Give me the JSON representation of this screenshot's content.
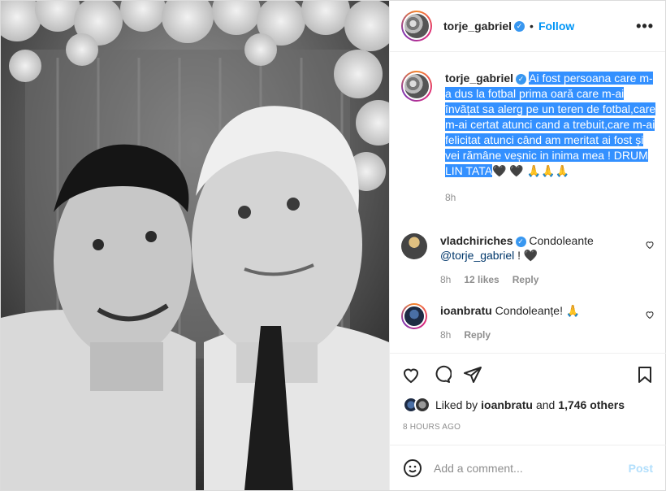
{
  "header": {
    "username": "torje_gabriel",
    "separator": "•",
    "follow_label": "Follow",
    "more_icon": "more-horizontal-icon"
  },
  "caption": {
    "username": "torje_gabriel",
    "text_1": "Ai fost persoana care m-a dus la fotbal prima oară care m-ai învățat sa alerg pe un teren de fotbal,care m-ai certat atunci cand a trebuit,care m-ai felicitat atunci când am meritat ai fost și vei rămâne veșnic in inima mea ! ",
    "text_2": "DRUM LIN TATA",
    "emojis": "🖤 🖤 🙏🙏🙏",
    "time": "8h"
  },
  "comments": [
    {
      "username": "vladchiriches",
      "text": "Condoleante",
      "mention": "@torje_gabriel",
      "trailing": "! 🖤",
      "time": "8h",
      "likes": "12 likes",
      "reply": "Reply"
    },
    {
      "username": "ioanbratu",
      "text": "Condoleanțe! 🙏",
      "time": "8h",
      "reply": "Reply"
    }
  ],
  "likes": {
    "prefix": "Liked by",
    "user": "ioanbratu",
    "joiner": "and",
    "others": "1,746 others"
  },
  "posted_ago": "8 HOURS AGO",
  "add_comment": {
    "placeholder": "Add a comment...",
    "post_label": "Post",
    "emoji_icon": "smile-icon"
  },
  "colors": {
    "accent": "#0095f6",
    "verified": "#3897f0",
    "highlight": "#3390ff"
  }
}
